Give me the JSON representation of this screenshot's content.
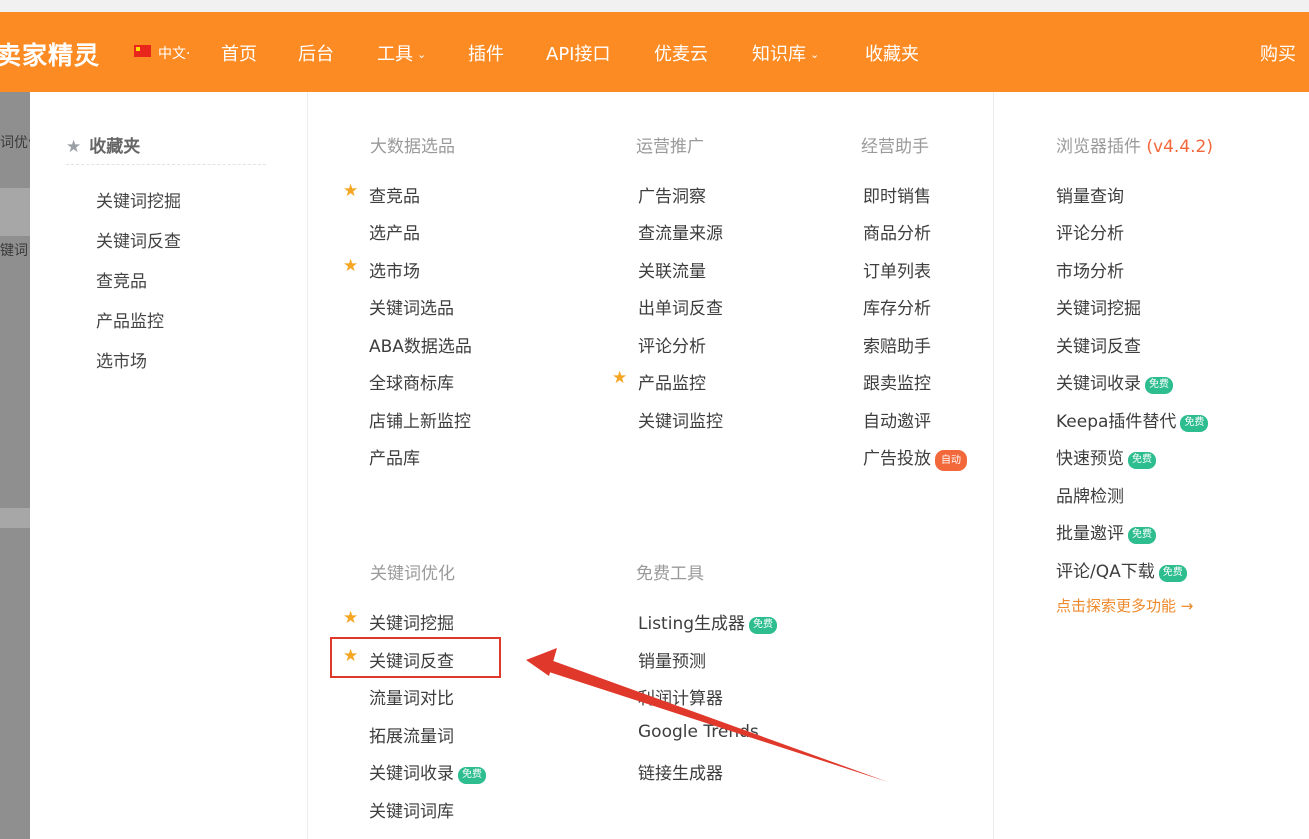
{
  "header": {
    "logo": "卖家精灵",
    "lang": "中文·",
    "nav": [
      {
        "label": "首页",
        "caret": false
      },
      {
        "label": "后台",
        "caret": false
      },
      {
        "label": "工具",
        "caret": true
      },
      {
        "label": "插件",
        "caret": false
      },
      {
        "label": "API接口",
        "caret": false
      },
      {
        "label": "优麦云",
        "caret": false
      },
      {
        "label": "知识库",
        "caret": true
      },
      {
        "label": "收藏夹",
        "caret": false
      }
    ],
    "buy": "购买"
  },
  "background": {
    "fragment_1": "词优化",
    "fragment_2": "键词"
  },
  "favorites": {
    "title": "收藏夹",
    "items": [
      "关键词挖掘",
      "关键词反查",
      "查竞品",
      "产品监控",
      "选市场"
    ]
  },
  "sections": {
    "big_data": {
      "title": "大数据选品",
      "items": [
        "查竞品",
        "选产品",
        "选市场",
        "关键词选品",
        "ABA数据选品",
        "全球商标库",
        "店铺上新监控",
        "产品库"
      ]
    },
    "operations": {
      "title": "运营推广",
      "items": [
        "广告洞察",
        "查流量来源",
        "关联流量",
        "出单词反查",
        "评论分析",
        "产品监控",
        "关键词监控"
      ]
    },
    "business": {
      "title": "经营助手",
      "items": [
        "即时销售",
        "商品分析",
        "订单列表",
        "库存分析",
        "索赔助手",
        "跟卖监控",
        "自动邀评",
        "广告投放"
      ],
      "auto_badge": "自动"
    },
    "keyword": {
      "title": "关键词优化",
      "items": [
        "关键词挖掘",
        "关键词反查",
        "流量词对比",
        "拓展流量词",
        "关键词收录",
        "关键词词库"
      ]
    },
    "free": {
      "title": "免费工具",
      "items": [
        "Listing生成器",
        "销量预测",
        "利润计算器",
        "Google Trends",
        "链接生成器"
      ]
    },
    "plugin": {
      "title": "浏览器插件",
      "version": "(v4.4.2)",
      "items": [
        "销量查询",
        "评论分析",
        "市场分析",
        "关键词挖掘",
        "关键词反查",
        "关键词收录",
        "Keepa插件替代",
        "快速预览",
        "品牌检测",
        "批量邀评",
        "评论/QA下载"
      ],
      "explore": "点击探索更多功能 →"
    },
    "free_badge": "免费"
  },
  "colors": {
    "navbar": "#fd8b23",
    "star": "#f5a623",
    "badge_free": "#2ebd8f",
    "badge_auto": "#f3683a",
    "annotation": "#e0382a"
  }
}
